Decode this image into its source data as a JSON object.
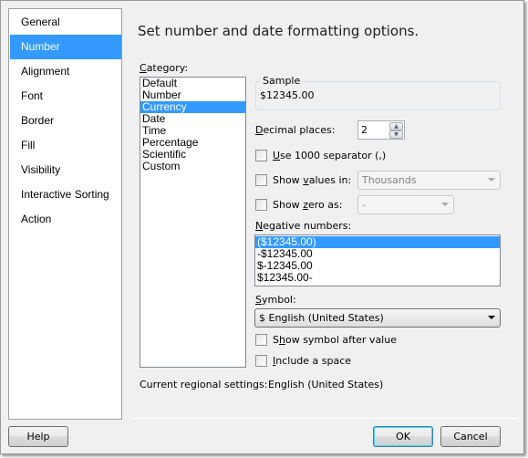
{
  "sidebar": {
    "items": [
      {
        "label": "General",
        "selected": false
      },
      {
        "label": "Number",
        "selected": true
      },
      {
        "label": "Alignment",
        "selected": false
      },
      {
        "label": "Font",
        "selected": false
      },
      {
        "label": "Border",
        "selected": false
      },
      {
        "label": "Fill",
        "selected": false
      },
      {
        "label": "Visibility",
        "selected": false
      },
      {
        "label": "Interactive Sorting",
        "selected": false
      },
      {
        "label": "Action",
        "selected": false
      }
    ]
  },
  "main": {
    "heading": "Set number and date formatting options.",
    "category": {
      "label_u": "C",
      "label_rest": "ategory:",
      "items": [
        "Default",
        "Number",
        "Currency",
        "Date",
        "Time",
        "Percentage",
        "Scientific",
        "Custom"
      ],
      "selected": "Currency"
    },
    "sample": {
      "title": "Sample",
      "value": "$12345.00"
    },
    "decimal_places": {
      "label_u": "D",
      "label_rest": "ecimal places:",
      "value": "2"
    },
    "use_separator": {
      "label_u": "U",
      "label_rest": "se 1000 separator (,)",
      "checked": false
    },
    "show_values_in": {
      "label_pre": "Show ",
      "label_u": "v",
      "label_rest": "alues in:",
      "checked": false,
      "value": "Thousands"
    },
    "show_zero_as": {
      "label_pre": "Show ",
      "label_u": "z",
      "label_rest": "ero as:",
      "checked": false,
      "value": "-"
    },
    "negative_numbers": {
      "label_u": "N",
      "label_rest": "egative numbers:",
      "items": [
        "($12345.00)",
        "-$12345.00",
        "$-12345.00",
        "$12345.00-"
      ],
      "selected": "($12345.00)"
    },
    "symbol": {
      "label_u": "S",
      "label_rest": "ymbol:",
      "value": "$ English (United States)"
    },
    "show_symbol_after": {
      "label_pre": "S",
      "label_u": "h",
      "label_rest": "ow symbol after value",
      "checked": false
    },
    "include_space": {
      "label_u": "I",
      "label_rest": "nclude a space",
      "checked": false
    },
    "regional": {
      "label": "Current regional settings:",
      "value": "English (United States)"
    }
  },
  "footer": {
    "help_label": "Help",
    "ok_label": "OK",
    "cancel_label": "Cancel"
  },
  "colors": {
    "selection": "#3399ff",
    "dialog_bg": "#f0f0f0"
  }
}
